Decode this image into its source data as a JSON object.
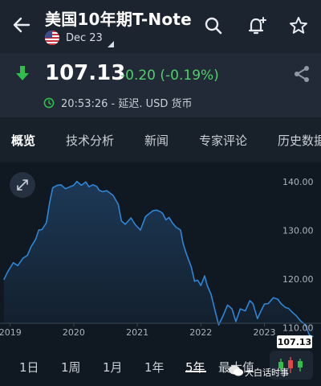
{
  "header": {
    "title": "美国10年期T-Note",
    "contract": "Dec 23"
  },
  "quote": {
    "price": "107.13",
    "change": "-0.20 (-0.19%)",
    "time_info": "20:53:26 - 延迟. USD 货币"
  },
  "tabs": [
    "概览",
    "技术分析",
    "新闻",
    "专家评论",
    "历史数据"
  ],
  "chart_data": {
    "type": "area",
    "x_labels": [
      "2019",
      "2020",
      "2021",
      "2022",
      "2023"
    ],
    "y_ticks": [
      110.0,
      120.0,
      130.0,
      140.0
    ],
    "ylim": [
      105,
      144
    ],
    "last_value_label": "107.13",
    "series": [
      {
        "points": [
          [
            2018.9,
            119.9
          ],
          [
            2018.96,
            121.5
          ],
          [
            2019.05,
            123.4
          ],
          [
            2019.12,
            122.8
          ],
          [
            2019.2,
            124.3
          ],
          [
            2019.27,
            124.9
          ],
          [
            2019.33,
            126.7
          ],
          [
            2019.4,
            128.2
          ],
          [
            2019.45,
            130.1
          ],
          [
            2019.5,
            130.2
          ],
          [
            2019.57,
            131.6
          ],
          [
            2019.62,
            135.7
          ],
          [
            2019.67,
            138.8
          ],
          [
            2019.74,
            139.3
          ],
          [
            2019.8,
            139.4
          ],
          [
            2019.87,
            138.6
          ],
          [
            2019.94,
            139.0
          ],
          [
            2020.0,
            139.3
          ],
          [
            2020.05,
            140.1
          ],
          [
            2020.12,
            139.3
          ],
          [
            2020.19,
            140.0
          ],
          [
            2020.24,
            139.0
          ],
          [
            2020.3,
            139.4
          ],
          [
            2020.36,
            139.1
          ],
          [
            2020.4,
            138.3
          ],
          [
            2020.45,
            138.0
          ],
          [
            2020.52,
            138.2
          ],
          [
            2020.62,
            137.2
          ],
          [
            2020.7,
            135.4
          ],
          [
            2020.75,
            132.0
          ],
          [
            2020.81,
            131.3
          ],
          [
            2020.9,
            132.6
          ],
          [
            2020.97,
            131.2
          ],
          [
            2021.05,
            130.1
          ],
          [
            2021.13,
            132.9
          ],
          [
            2021.18,
            133.4
          ],
          [
            2021.25,
            134.1
          ],
          [
            2021.3,
            134.2
          ],
          [
            2021.36,
            133.9
          ],
          [
            2021.4,
            133.5
          ],
          [
            2021.45,
            132.2
          ],
          [
            2021.5,
            132.7
          ],
          [
            2021.55,
            131.6
          ],
          [
            2021.61,
            130.7
          ],
          [
            2021.68,
            130.1
          ],
          [
            2021.72,
            127.4
          ],
          [
            2021.77,
            125.3
          ],
          [
            2021.85,
            122.5
          ],
          [
            2021.9,
            119.6
          ],
          [
            2021.95,
            119.8
          ],
          [
            2022.0,
            118.7
          ],
          [
            2022.06,
            120.7
          ],
          [
            2022.1,
            118.7
          ],
          [
            2022.16,
            116.9
          ],
          [
            2022.23,
            113.2
          ],
          [
            2022.28,
            110.6
          ],
          [
            2022.35,
            112.5
          ],
          [
            2022.42,
            114.7
          ],
          [
            2022.49,
            113.9
          ],
          [
            2022.55,
            111.3
          ],
          [
            2022.62,
            113.9
          ],
          [
            2022.7,
            113.5
          ],
          [
            2022.77,
            115.6
          ],
          [
            2022.82,
            115.0
          ],
          [
            2022.89,
            111.9
          ],
          [
            2022.95,
            113.6
          ],
          [
            2023.0,
            114.9
          ],
          [
            2023.06,
            115.0
          ],
          [
            2023.14,
            116.2
          ],
          [
            2023.21,
            115.9
          ],
          [
            2023.26,
            115.0
          ],
          [
            2023.33,
            114.2
          ],
          [
            2023.38,
            114.0
          ],
          [
            2023.44,
            113.2
          ],
          [
            2023.5,
            112.5
          ],
          [
            2023.57,
            111.4
          ],
          [
            2023.64,
            110.7
          ],
          [
            2023.71,
            108.5
          ],
          [
            2023.77,
            108.2
          ]
        ]
      }
    ],
    "colors": {
      "line": "#2f86d6",
      "area": "#1d3a59"
    }
  },
  "ranges": [
    "1日",
    "1周",
    "1月",
    "1年",
    "5年",
    "最大值"
  ],
  "active_range": "5年",
  "watermark": "大白话时事",
  "icons": [
    "back-arrow-icon",
    "search-icon",
    "add-alert-icon",
    "star-icon",
    "down-arrow-icon",
    "share-icon",
    "clock-icon",
    "expand-icon",
    "candlestick-icon"
  ]
}
